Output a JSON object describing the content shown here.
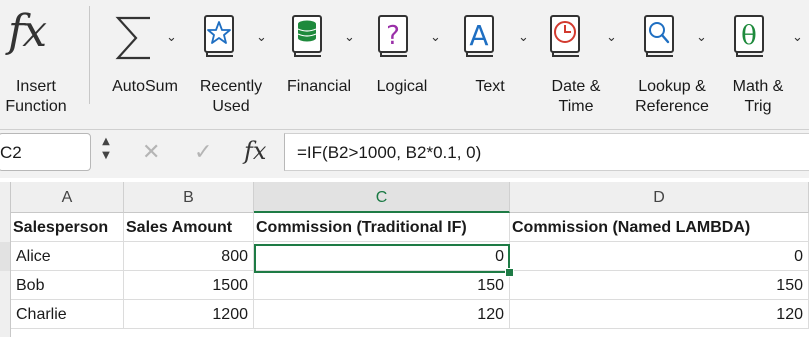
{
  "ribbon": {
    "insert_function": "Insert\nFunction",
    "autosum": "AutoSum",
    "recently_used": "Recently\nUsed",
    "financial": "Financial",
    "logical": "Logical",
    "text": "Text",
    "date_time": "Date &\nTime",
    "lookup_reference": "Lookup &\nReference",
    "math_trig": "Math &\nTrig"
  },
  "formula_bar": {
    "name_box": "C2",
    "formula": "=IF(B2>1000, B2*0.1, 0)"
  },
  "sheet": {
    "columns": [
      "A",
      "B",
      "C",
      "D"
    ],
    "active_column": "C",
    "header_row": [
      "Salesperson",
      "Sales Amount",
      "Commission (Traditional IF)",
      "Commission (Named LAMBDA)"
    ],
    "rows": [
      [
        "Alice",
        "800",
        "0",
        "0"
      ],
      [
        "Bob",
        "1500",
        "150",
        "150"
      ],
      [
        "Charlie",
        "1200",
        "120",
        "120"
      ]
    ],
    "selected_cell": "C2"
  },
  "colors": {
    "accent_green": "#1e7b45",
    "logical_purple": "#9a2fa8",
    "text_blue": "#1f6fc2",
    "date_red": "#d23a2f",
    "lookup_blue": "#1f6fc2",
    "math_green": "#1e8a3c"
  }
}
